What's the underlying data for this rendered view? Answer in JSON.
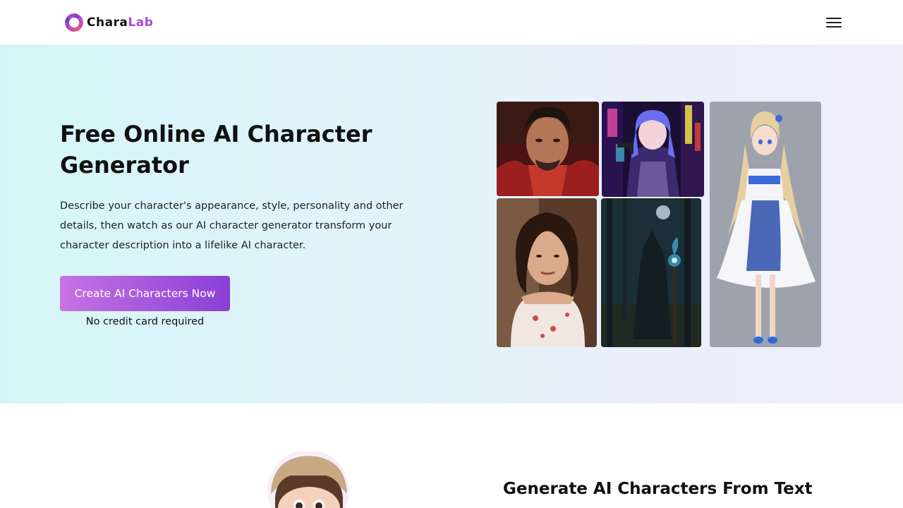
{
  "header": {
    "logo_part1": "Chara",
    "logo_part2": "Lab",
    "logo_mark_icon": "swirl-logo-icon",
    "menu_icon": "hamburger-menu-icon"
  },
  "hero": {
    "title": "Free Online AI Character Generator",
    "description": "Describe your character's appearance, style, personality and other details, then watch as our AI character generator transform your character description into a lifelike AI character.",
    "cta_label": "Create AI Characters Now",
    "cta_note": "No credit card required",
    "gallery": [
      "portrait-man-red-hoodie",
      "anime-girl-neon-city",
      "portrait-woman-floral-dress",
      "wizard-dark-forest",
      "anime-girl-white-dress"
    ]
  },
  "features": {
    "title": "Generate AI Characters From Text",
    "image": "cartoon-girl-beret-avatar"
  },
  "colors": {
    "accent": "#a456dc",
    "accent_light": "#c773e3",
    "hero_bg_start": "#d5f6f8",
    "hero_bg_end": "#f1eefc",
    "text": "#111111"
  }
}
